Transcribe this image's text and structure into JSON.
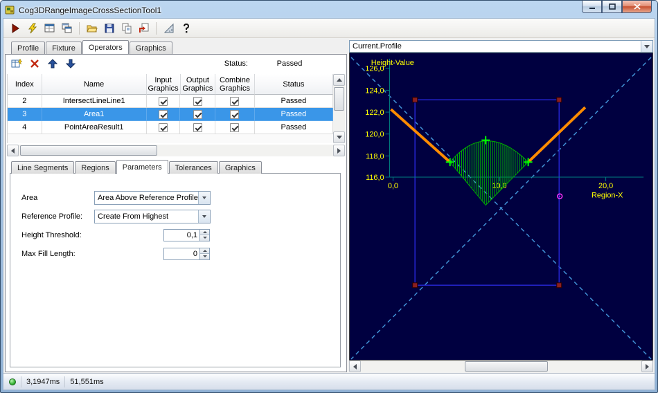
{
  "window": {
    "title": "Cog3DRangeImageCrossSectionTool1"
  },
  "titlebar_buttons": {
    "minimize": "minimize-button",
    "maximize": "maximize-button",
    "close": "close-button"
  },
  "toolbar": {
    "icons": [
      "run-icon",
      "lightning-icon",
      "tool-editors-icon",
      "add-editor-icon",
      "open-folder-icon",
      "save-icon",
      "copy-pages-icon",
      "import-icon",
      "set-square-icon",
      "help-icon"
    ]
  },
  "main_tabs": {
    "items": [
      {
        "label": "Profile"
      },
      {
        "label": "Fixture"
      },
      {
        "label": "Operators"
      },
      {
        "label": "Graphics"
      }
    ],
    "active": "Operators"
  },
  "operators": {
    "toolbar": {
      "icons": [
        "add-operator-icon",
        "delete-operator-icon",
        "move-up-icon",
        "move-down-icon"
      ],
      "status_label": "Status:",
      "status_value": "Passed"
    },
    "table": {
      "columns": [
        "Index",
        "Name",
        "Input Graphics",
        "Output Graphics",
        "Combine Graphics",
        "Status"
      ],
      "rows": [
        {
          "index": "2",
          "name": "IntersectLineLine1",
          "input_graphics": true,
          "output_graphics": true,
          "combine_graphics": true,
          "status": "Passed",
          "selected": false
        },
        {
          "index": "3",
          "name": "Area1",
          "input_graphics": true,
          "output_graphics": true,
          "combine_graphics": true,
          "status": "Passed",
          "selected": true
        },
        {
          "index": "4",
          "name": "PointAreaResult1",
          "input_graphics": true,
          "output_graphics": true,
          "combine_graphics": true,
          "status": "Passed",
          "selected": false
        }
      ]
    }
  },
  "sub_tabs": {
    "items": [
      {
        "label": "Line Segments"
      },
      {
        "label": "Regions"
      },
      {
        "label": "Parameters"
      },
      {
        "label": "Tolerances"
      },
      {
        "label": "Graphics"
      }
    ],
    "active": "Parameters"
  },
  "parameters": {
    "area_label": "Area",
    "area_value": "Area Above Reference Profile",
    "reference_label": "Reference Profile:",
    "reference_value": "Create From Highest",
    "height_threshold_label": "Height Threshold:",
    "height_threshold_value": "0,1",
    "max_fill_label": "Max Fill Length:",
    "max_fill_value": "0"
  },
  "profile": {
    "header": "Current.Profile",
    "ylabel": "Height-Value",
    "xlabel": "Region-X",
    "y_ticks": [
      "126,0",
      "124,0",
      "122,0",
      "120,0",
      "118,0",
      "116,0"
    ],
    "x_ticks": [
      "0,0",
      "10,0",
      "20,0"
    ],
    "colors": {
      "background": "#000040",
      "axis": "#008080",
      "labels": "#ffff00",
      "crosshair_dashed": "#4191d6",
      "region_rect": "#2525cf",
      "handles": "#8a1f1f",
      "profile_line": "#ff8c00",
      "area_hatch": "#00b400",
      "markers": "#00ff00",
      "point_marker": "#ff30ff"
    }
  },
  "status_bar": {
    "time1": "3,1947ms",
    "time2": "51,551ms"
  }
}
